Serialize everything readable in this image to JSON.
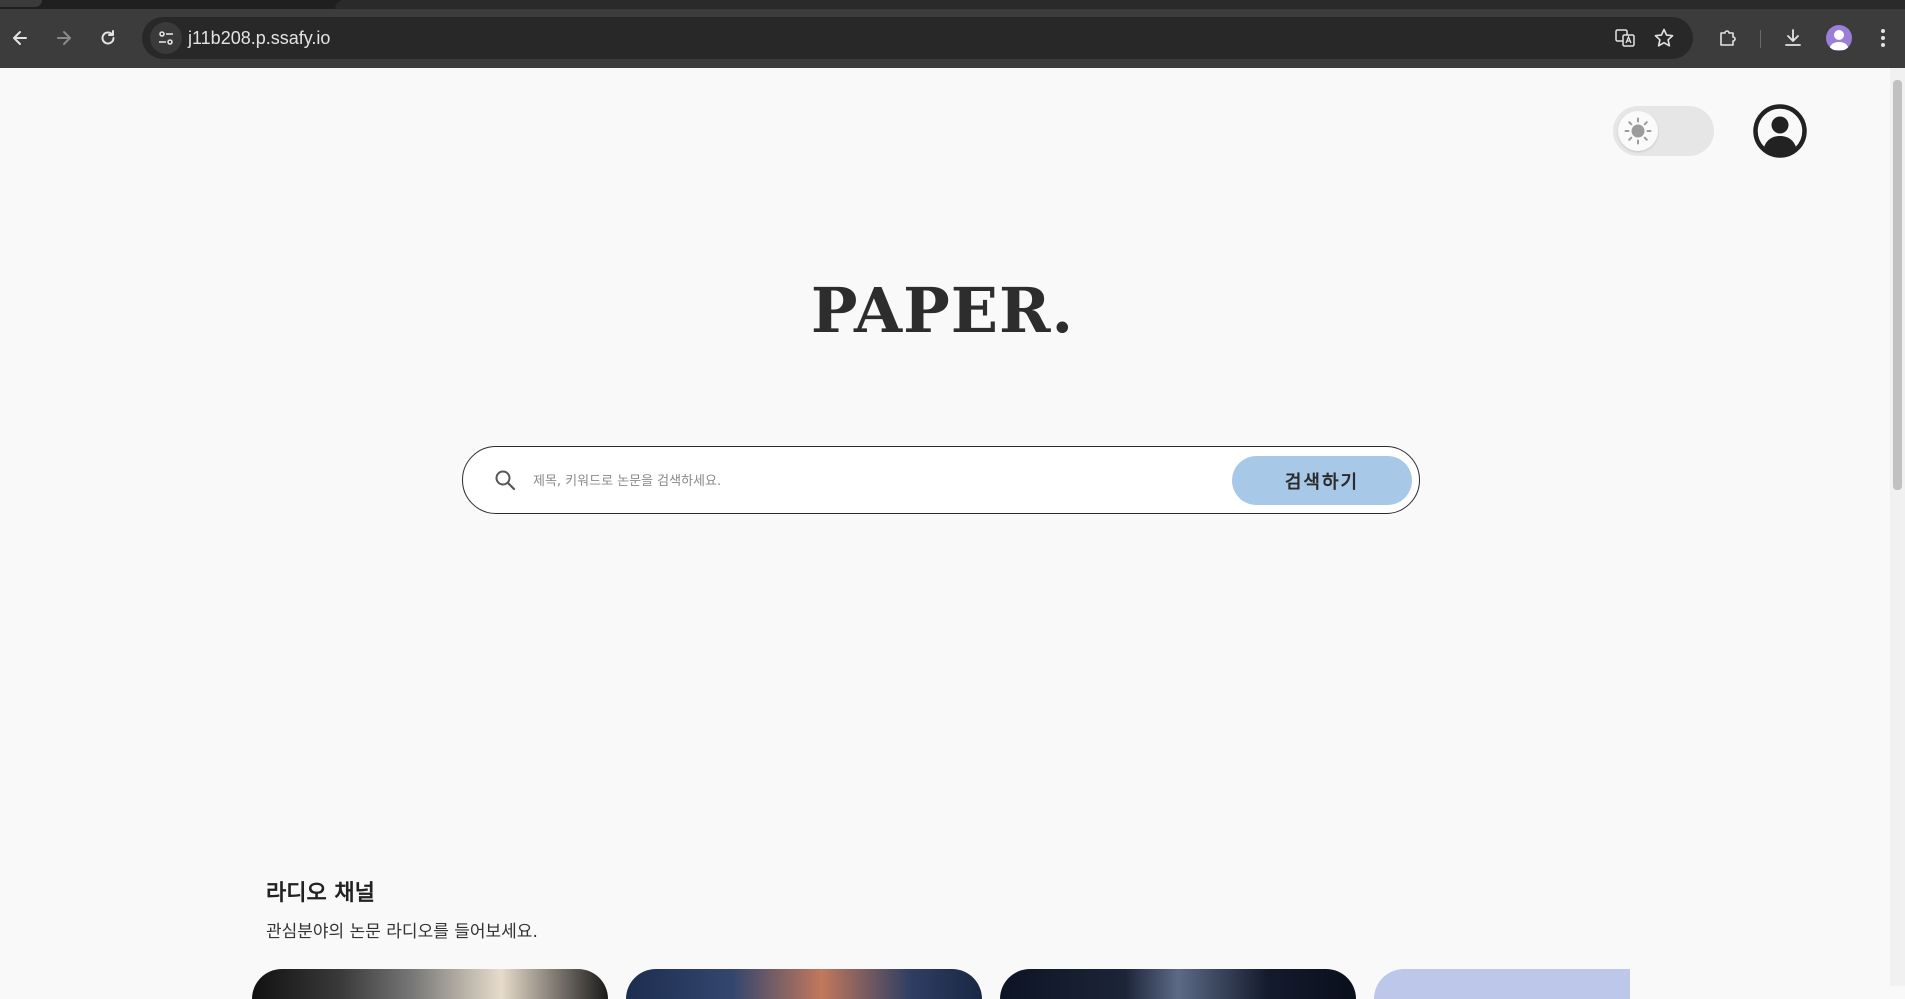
{
  "browser": {
    "url": "j11b208.p.ssafy.io"
  },
  "header": {
    "theme_toggle_state": "light",
    "icons": [
      "sun-icon",
      "user-circle-icon"
    ]
  },
  "hero": {
    "logo": "PAPER."
  },
  "search": {
    "placeholder": "제목, 키워드로 논문을 검색하세요.",
    "value": "",
    "button_label": "검색하기"
  },
  "radio_section": {
    "title": "라디오 채널",
    "subtitle": "관심분야의 논문 라디오를 들어보세요.",
    "cards": [
      {
        "theme": "dark-photo"
      },
      {
        "theme": "blue-bokeh"
      },
      {
        "theme": "night-city"
      },
      {
        "theme": "lavender"
      }
    ]
  },
  "colors": {
    "page_bg": "#f9f9f9",
    "search_button": "#a8c8e8",
    "logo": "#2d2d2d",
    "chrome_toolbar": "#3c3c3c"
  }
}
